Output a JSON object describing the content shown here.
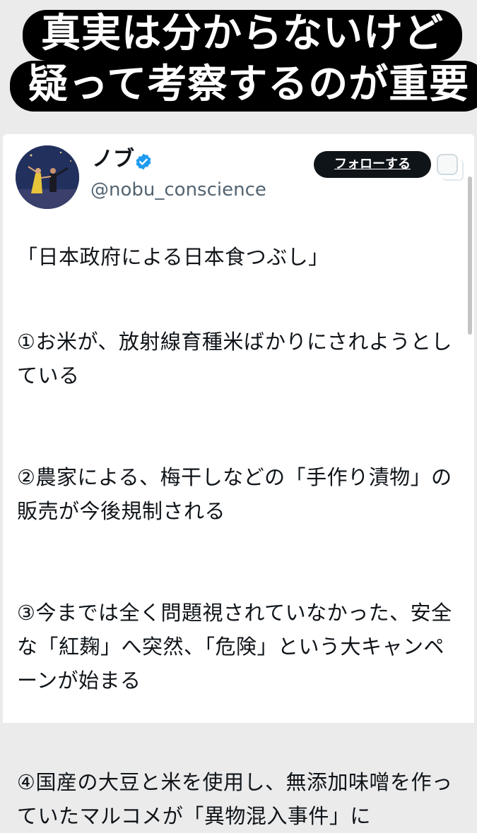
{
  "caption": {
    "line1": "真実は分からないけど",
    "line2": "疑って考察するのが重要"
  },
  "tweet": {
    "user": {
      "name": "ノブ",
      "handle": "@nobu_conscience",
      "verified": true
    },
    "follow_label": "フォローする",
    "paragraphs": [
      "「日本政府による日本食つぶし」",
      "①お米が、放射線育種米ばかりにされようとしている",
      "②農家による、梅干しなどの「手作り漬物」の販売が今後規制される",
      "③今までは全く問題視されていなかった、安全な「紅麹」へ突然、「危険」という大キャンペーンが始まる",
      "④国産の大豆と米を使用し、無添加味噌を作っていたマルコメが「異物混入事件」に"
    ]
  },
  "colors": {
    "caption_bg": "#000000",
    "caption_text": "#ffffff",
    "follow_bg": "#0f1419",
    "verified": "#1d9bf0",
    "handle": "#536471"
  },
  "icons": {
    "verified": "verified-badge-icon",
    "more": "more-options-icon"
  }
}
